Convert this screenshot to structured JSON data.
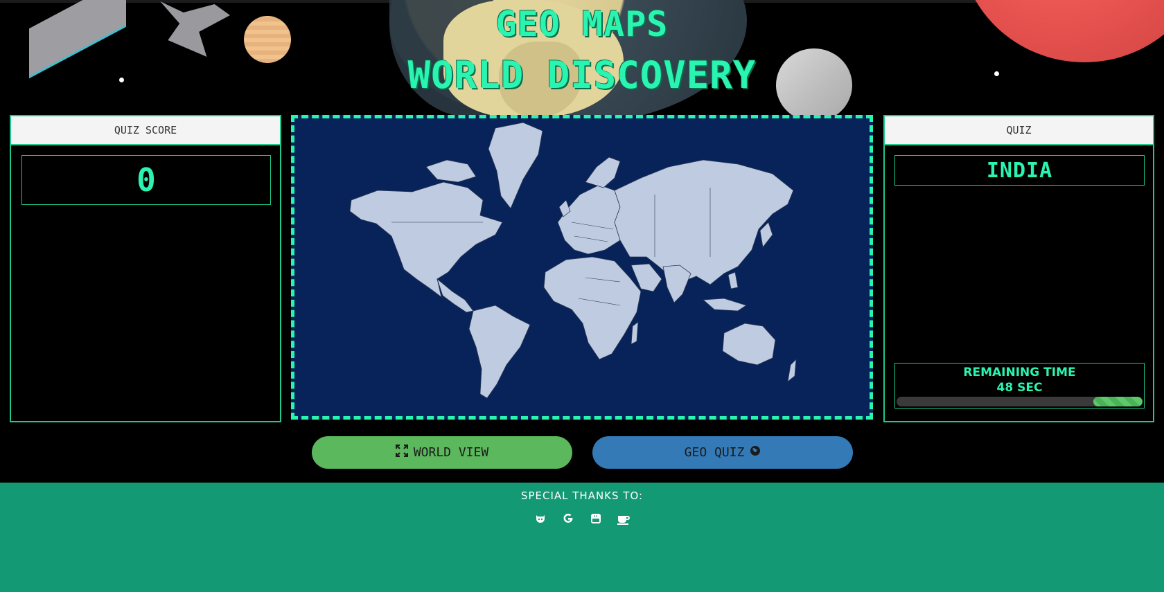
{
  "header": {
    "title_line1": "GEO MAPS",
    "title_line2": "WORLD DISCOVERY"
  },
  "score_panel": {
    "heading": "QUIZ SCORE",
    "score": "0"
  },
  "quiz_panel": {
    "heading": "QUIZ",
    "country": "INDIA",
    "timer_label": "REMAINING TIME",
    "timer_value": "48 SEC",
    "time_progress_fraction": 0.2
  },
  "buttons": {
    "world_view_label": "WORLD VIEW",
    "world_view_icon": "expand-icon",
    "geo_quiz_label": "GEO QUIZ",
    "geo_quiz_icon": "globe-icon"
  },
  "footer": {
    "title": "SPECIAL THANKS TO:",
    "links": [
      "github-icon",
      "google-icon",
      "youtube-icon",
      "coffee-icon"
    ]
  },
  "colors": {
    "accent": "#2af5b0",
    "map_ocean": "#07235a",
    "map_land": "#bfcbe0",
    "footer_bg": "#139a74",
    "world_view_btn": "#5cb85c",
    "geo_quiz_btn": "#337ab7"
  }
}
